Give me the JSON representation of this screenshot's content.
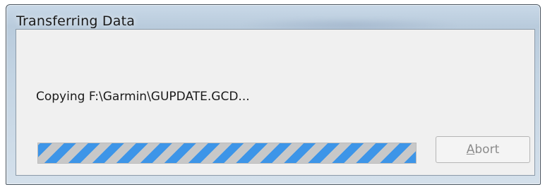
{
  "window": {
    "title": "Transferring Data"
  },
  "dialog": {
    "message": "Copying F:\\Garmin\\GUPDATE.GCD...",
    "progress": {
      "style": "indeterminate-marquee",
      "stripe_colors": [
        "#3d95e8",
        "#c8c8c8"
      ]
    },
    "abort_button": {
      "label_first": "A",
      "label_rest": "bort",
      "enabled": false
    }
  }
}
